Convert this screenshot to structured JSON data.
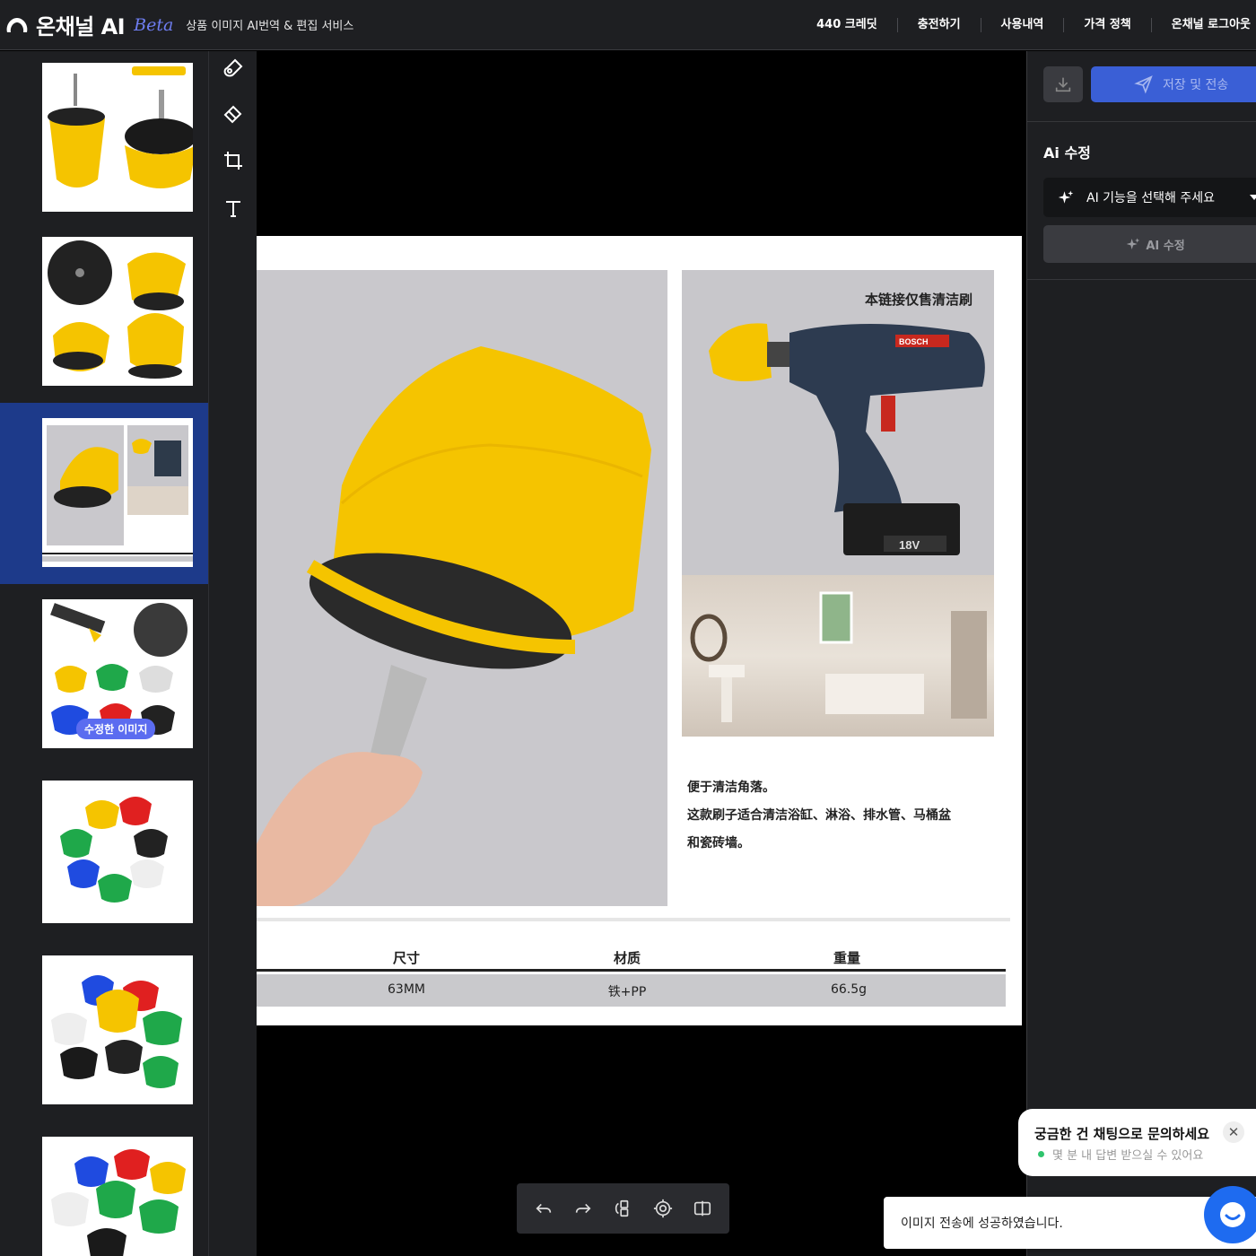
{
  "header": {
    "logo_name": "온채널 AI",
    "logo_beta": "Beta",
    "subtitle": "상품 이미지 AI번역 & 편집 서비스",
    "nav": [
      "440 크레딧",
      "충전하기",
      "사용내역",
      "가격 정책",
      "온채널 로그아웃"
    ]
  },
  "thumbnails": {
    "edited_badge": "수정한 이미지",
    "selected_index": 2,
    "count": 7
  },
  "tools": [
    "brush-icon",
    "eraser-icon",
    "crop-icon",
    "text-tool-icon"
  ],
  "product_image": {
    "right_caption": "本链接仅售清洁刷",
    "drill_battery_label": "18V",
    "drill_brand": "BOSCH",
    "description": [
      "便于清洁角落。",
      "这款刷子适合清洁浴缸、淋浴、排水管、马桶盆",
      "和瓷砖墙。"
    ],
    "spec_headers": [
      "尺寸",
      "材质",
      "重量"
    ],
    "spec_values": [
      "63MM",
      "铁+PP",
      "66.5g"
    ]
  },
  "bottom_toolbar": [
    "undo-icon",
    "redo-icon",
    "compare-icon",
    "target-icon",
    "split-view-icon"
  ],
  "right_panel": {
    "save_send_label": "저장 및 전송",
    "title": "Ai 수정",
    "ai_select_placeholder": "AI 기능을 선택해 주세요",
    "ai_button_label": "AI 수정"
  },
  "chat": {
    "title": "궁금한 건 채팅으로 문의하세요",
    "subtitle": "몇 분 내 답변 받으실 수 있어요"
  },
  "toast": {
    "message": "이미지 전송에 성공하였습니다."
  },
  "colors": {
    "accent": "#3a5fd6",
    "selected_thumb": "#1d3a8a",
    "brush_yellow": "#f5c400",
    "panel_dark": "#1e1f22"
  }
}
